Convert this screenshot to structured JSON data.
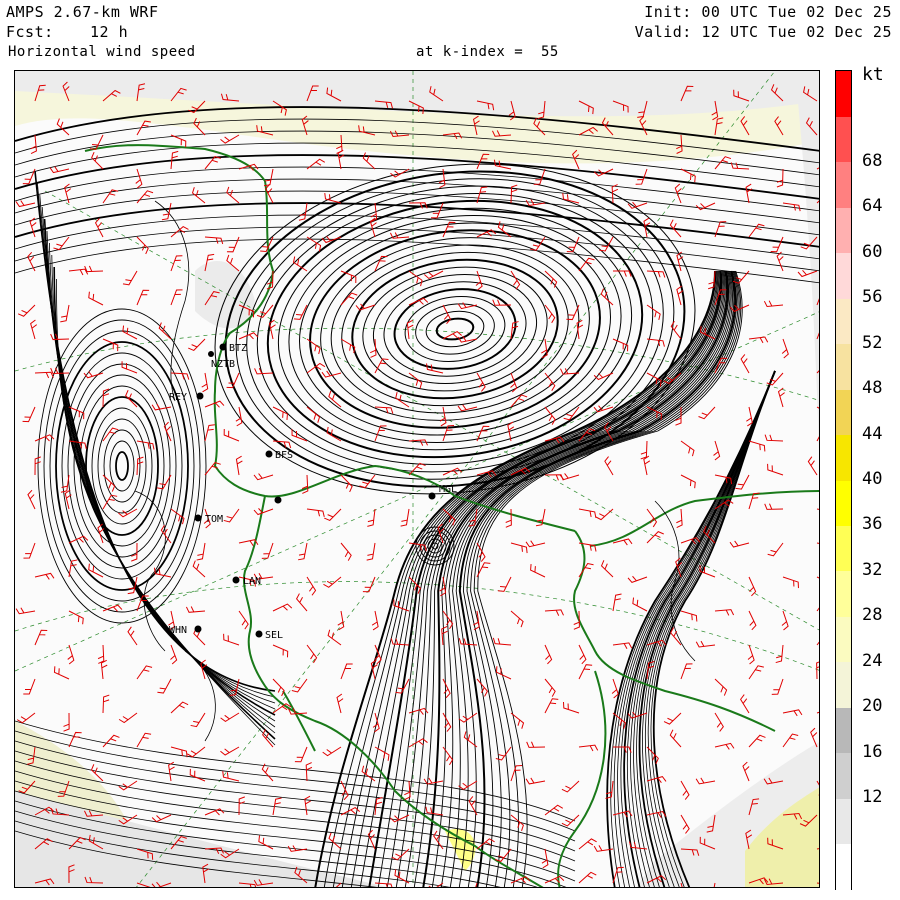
{
  "header": {
    "model": "AMPS 2.67-km WRF",
    "fcst_label": "Fcst:",
    "fcst_value": "12 h",
    "field": "Horizontal wind speed",
    "level": "at k-index =  55",
    "init": "Init: 00 UTC Tue 02 Dec 25",
    "valid": "Valid: 12 UTC Tue 02 Dec 25"
  },
  "colorbar": {
    "unit": "kt",
    "ticks": [
      "12",
      "16",
      "20",
      "24",
      "28",
      "32",
      "36",
      "40",
      "44",
      "48",
      "52",
      "56",
      "60",
      "64",
      "68"
    ],
    "colors": [
      "#ffffff",
      "#e8e8e8",
      "#cfcfcf",
      "#b8b8b8",
      "#f4f4d8",
      "#fbfbc0",
      "#ffff9a",
      "#ffff55",
      "#ffff00",
      "#f7e600",
      "#f2d455",
      "#f7e2a0",
      "#fbe9c4",
      "#ffd9d9",
      "#ffb0b0",
      "#ff8080",
      "#ff5050",
      "#ff0000"
    ]
  },
  "stations": [
    {
      "id": "BTZ",
      "label": "BTZ"
    },
    {
      "id": "NZTB",
      "label": "NZTB"
    },
    {
      "id": "REY",
      "label": "REY"
    },
    {
      "id": "BFS",
      "label": "BFS"
    },
    {
      "id": "TOM",
      "label": "TOM"
    },
    {
      "id": "LAN",
      "label": "LAN"
    },
    {
      "id": "WHN",
      "label": "WHN"
    },
    {
      "id": "SEL",
      "label": "SEL"
    },
    {
      "id": "MGL",
      "label": "MGL"
    }
  ],
  "colors": {
    "coastline": "#1a7a1a",
    "wind_barbs": "#e00000",
    "streamlines": "#000000",
    "graticule": "#2a8a2a"
  }
}
